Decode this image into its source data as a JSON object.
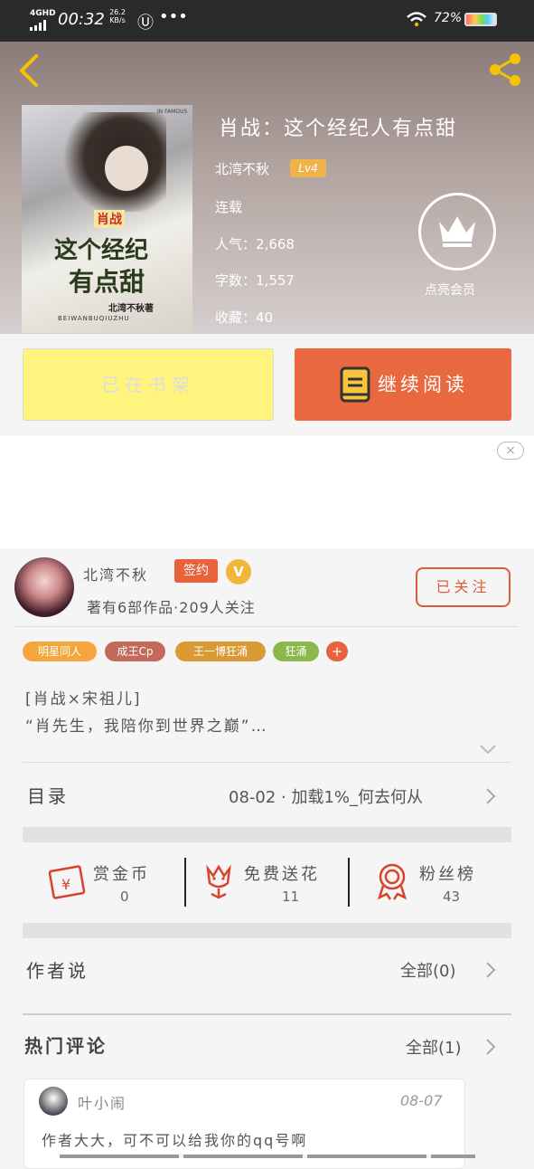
{
  "status_bar": {
    "network": "4GHD",
    "time": "00:32",
    "speed_value": "26.2",
    "speed_unit": "KB/s",
    "app_icon": "Ⓤ",
    "more": "•••",
    "battery": "72%"
  },
  "book": {
    "title": "肖战：这个经纪人有点甜",
    "author": "北湾不秋",
    "level": "Lv4",
    "status": "连载",
    "popularity_label": "人气：",
    "popularity": "2,668",
    "words_label": "字数：",
    "words": "1,557",
    "favorites_label": "收藏：",
    "favorites": "40",
    "vip_label": "点亮会员",
    "cover": {
      "top_text": "IN FAMOUS",
      "title_line1": "肖战",
      "title_line2": "这个经纪",
      "title_line3": "有点甜",
      "author": "北湾不秋著",
      "pinyin": "BEIWANBUQIUZHU"
    }
  },
  "actions": {
    "in_shelf": "已在书架",
    "continue_reading": "继续阅读"
  },
  "ad": {
    "close": "×"
  },
  "author_info": {
    "name": "北湾不秋",
    "signed": "签约",
    "v_badge": "V",
    "meta": "著有6部作品·209人关注",
    "follow": "已关注"
  },
  "tags": [
    {
      "label": "明星同人",
      "color": "#f2a63c"
    },
    {
      "label": "成王Cp",
      "color": "#c46a5a"
    },
    {
      "label": "王一博狂涌",
      "color": "#d99a36"
    },
    {
      "label": "狂涌",
      "color": "#8bb84a"
    },
    {
      "label": "+",
      "color": "#e9623c"
    }
  ],
  "description": {
    "line1": "[肖战×宋祖儿]",
    "line2": "“肖先生，我陪你到世界之巅”…"
  },
  "catalog": {
    "label": "目录",
    "latest": "08-02 · 加载1%_何去何从"
  },
  "stats": [
    {
      "label": "赏金币",
      "value": "0"
    },
    {
      "label": "免费送花",
      "value": "11"
    },
    {
      "label": "粉丝榜",
      "value": "43"
    }
  ],
  "author_says": {
    "label": "作者说",
    "right": "全部(0)"
  },
  "hot_comments": {
    "label": "热门评论",
    "right": "全部(1)"
  },
  "comment": {
    "user": "叶小闹",
    "date": "08-07",
    "text": "作者大大，可不可以给我你的qq号啊"
  },
  "colors": {
    "accent": "#e9623c",
    "shelf_button": "#fff47e",
    "level_badge": "#f0b24a"
  }
}
